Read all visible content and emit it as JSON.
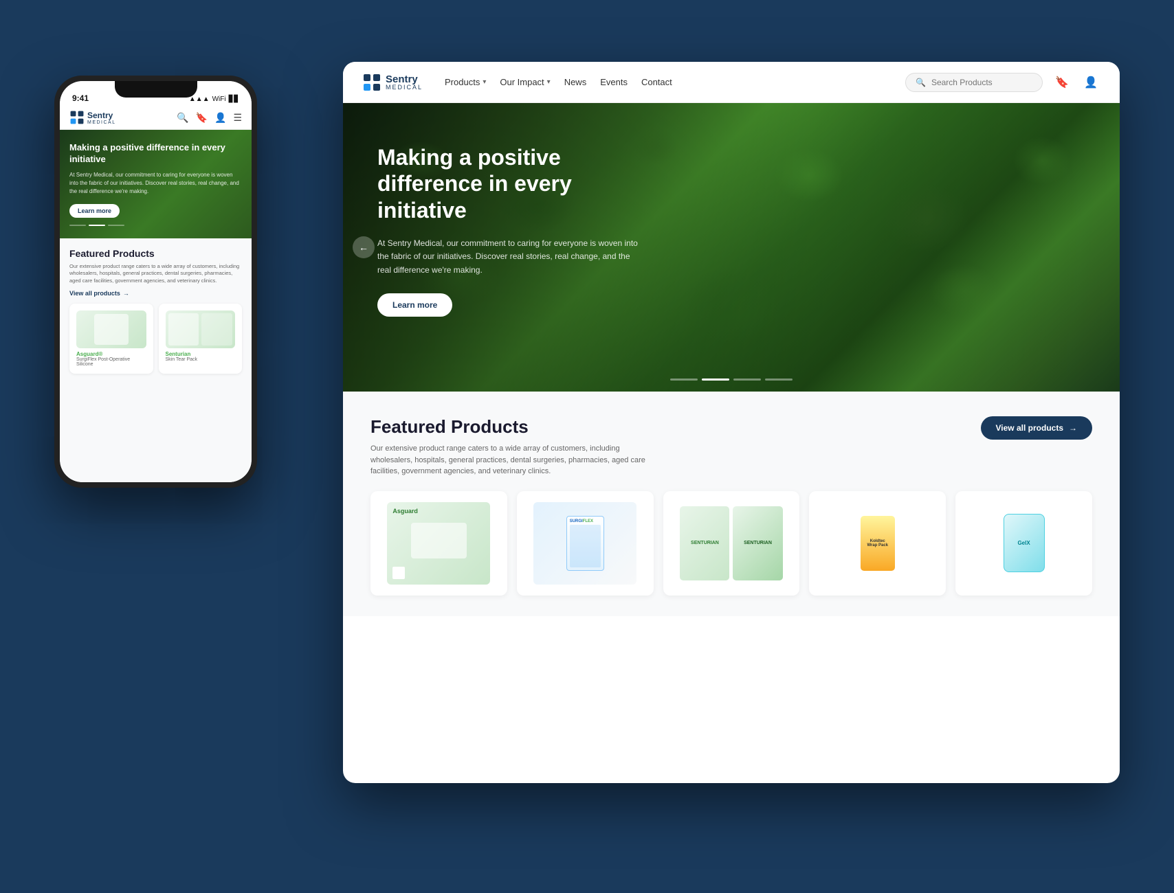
{
  "brand": {
    "name_sentry": "Sentry",
    "name_medical": "MEDICAL",
    "tagline": "Sentry MEDICAL"
  },
  "desktop": {
    "nav": {
      "products_label": "Products",
      "our_impact_label": "Our Impact",
      "news_label": "News",
      "events_label": "Events",
      "contact_label": "Contact",
      "search_placeholder": "Search Products"
    },
    "hero": {
      "title": "Making a positive difference in every initiative",
      "description": "At Sentry Medical, our commitment to caring for everyone is woven into the fabric of our initiatives. Discover real stories, real change, and the real difference we're making.",
      "cta_label": "Learn more"
    },
    "featured": {
      "section_title": "Featured Products",
      "section_desc": "Our extensive product range caters to a wide array of customers, including wholesalers, hospitals, general practices, dental surgeries, pharmacies, aged care facilities, government agencies, and veterinary clinics.",
      "view_all_label": "View all products",
      "products": [
        {
          "id": "asguard",
          "type": "asguard"
        },
        {
          "id": "surgiflex",
          "type": "surgiflex"
        },
        {
          "id": "senturian",
          "type": "senturian"
        },
        {
          "id": "wrappack",
          "type": "wrappack"
        },
        {
          "id": "gelx",
          "type": "gelx"
        }
      ]
    }
  },
  "mobile": {
    "status": {
      "time": "9:41",
      "signal": "●●●",
      "wifi": "WiFi",
      "battery": "▊▊▊"
    },
    "hero": {
      "title": "Making a positive difference in every initiative",
      "description": "At Sentry Medical, our commitment to caring for everyone is woven into the fabric of our initiatives. Discover real stories, real change, and the real difference we're making.",
      "cta_label": "Learn more"
    },
    "featured": {
      "title": "Featured Products",
      "desc": "Our extensive product range caters to a wide array of customers, including wholesalers, hospitals, general practices, dental surgeries, pharmacies, aged care facilities, government agencies, and veterinary clinics.",
      "view_all_label": "View all products",
      "products": [
        {
          "name": "Asguard®",
          "sub": "SurgiFlex Post-Operative Silicone",
          "type": "asguard"
        },
        {
          "name": "Senturian",
          "sub": "Skin Tear Pack",
          "type": "senturian"
        }
      ]
    }
  }
}
